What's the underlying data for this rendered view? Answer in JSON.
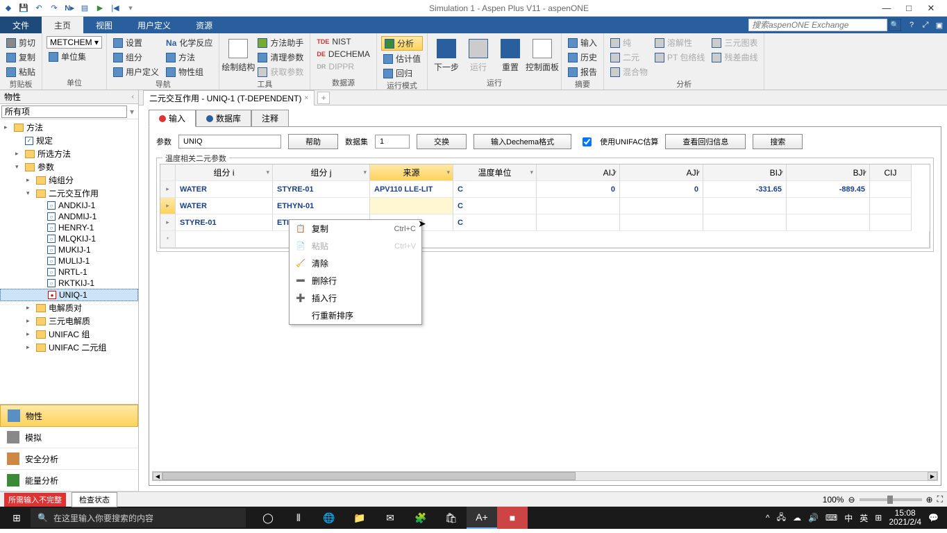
{
  "title": "Simulation 1 - Aspen Plus V11 - aspenONE",
  "search_placeholder": "搜索aspenONE Exchange",
  "ribbon_tabs": {
    "file": "文件",
    "home": "主页",
    "view": "视图",
    "custom": "用户定义",
    "res": "资源"
  },
  "ribbon": {
    "clipboard": {
      "cut": "剪切",
      "copy": "复制",
      "paste": "粘贴",
      "g": "剪贴板"
    },
    "units": {
      "combo": "METCHEM",
      "set": "单位集",
      "g": "单位"
    },
    "nav": {
      "setup": "设置",
      "comp": "组分",
      "userdef": "用户定义",
      "chem": "化学反应",
      "method": "方法",
      "propset": "物性组",
      "drawstruct": "绘制结构",
      "g": "导航"
    },
    "tools": {
      "methodassist": "方法助手",
      "cleanparam": "清理参数",
      "getparam": "获取参数",
      "g": "工具"
    },
    "datasrc": {
      "nist": "NIST",
      "dechema": "DECHEMA",
      "dippr": "DIPPR",
      "g": "数据源"
    },
    "runmode": {
      "analyze": "分析",
      "estimate": "估计值",
      "regress": "回归",
      "g": "运行模式"
    },
    "run": {
      "next": "下一步",
      "go": "运行",
      "reset": "重置",
      "cpanel": "控制面板",
      "g": "运行"
    },
    "summary": {
      "input": "输入",
      "hist": "历史",
      "rep": "报告",
      "pure": "纯",
      "binary": "二元",
      "mix": "混合物",
      "g": "摘要"
    },
    "analysis": {
      "sol": "溶解性",
      "pt": "PT 包络线",
      "ternary": "三元图表",
      "resid": "残差曲线",
      "g": "分析"
    }
  },
  "left": {
    "title": "物性",
    "filter": "所有项",
    "tree": {
      "method": "方法",
      "spec": "规定",
      "selmethod": "所选方法",
      "param": "参数",
      "purecomp": "纯组分",
      "binary": "二元交互作用",
      "items": [
        "ANDKIJ-1",
        "ANDMIJ-1",
        "HENRY-1",
        "MLQKIJ-1",
        "MUKIJ-1",
        "MULIJ-1",
        "NRTL-1",
        "RKTKIJ-1",
        "UNIQ-1"
      ],
      "elec": "电解质对",
      "ternelec": "三元电解质",
      "unifacg": "UNIFAC 组",
      "unifacb": "UNIFAC 二元组"
    },
    "nav": {
      "props": "物性",
      "sim": "模拟",
      "safety": "安全分析",
      "energy": "能量分析"
    }
  },
  "doc_tab": "二元交互作用 - UNIQ-1 (T-DEPENDENT)",
  "subtabs": {
    "input": "输入",
    "db": "数据库",
    "notes": "注释"
  },
  "params": {
    "label": "参数",
    "value": "UNIQ",
    "help": "帮助",
    "dataset_label": "数据集",
    "dataset": "1",
    "swap": "交换",
    "dechema": "输入Dechema格式",
    "unifac": "使用UNIFAC估算",
    "viewreg": "查看回归信息",
    "search": "搜索"
  },
  "grid": {
    "legend": "温度相关二元参数",
    "headers": {
      "ci": "组分 i",
      "cj": "组分 j",
      "src": "来源",
      "tu": "温度单位",
      "aij": "AIJ",
      "aji": "AJI",
      "bij": "BIJ",
      "bji": "BJI",
      "cij": "CIJ"
    },
    "rows": [
      {
        "ci": "WATER",
        "cj": "STYRE-01",
        "src": "APV110 LLE-LIT",
        "tu": "C",
        "aij": "0",
        "aji": "0",
        "bij": "-331.65",
        "bji": "-889.45"
      },
      {
        "ci": "WATER",
        "cj": "ETHYN-01",
        "src": "",
        "tu": "C",
        "aij": "",
        "aji": "",
        "bij": "",
        "bji": ""
      },
      {
        "ci": "STYRE-01",
        "cj": "ETI",
        "src": "",
        "tu": "C",
        "aij": "",
        "aji": "",
        "bij": "",
        "bji": ""
      }
    ]
  },
  "ctx": {
    "copy": "复制",
    "copy_sc": "Ctrl+C",
    "paste": "粘贴",
    "paste_sc": "Ctrl+V",
    "clear": "清除",
    "delrow": "删除行",
    "insrow": "插入行",
    "reorder": "行重新排序"
  },
  "status": {
    "err": "所需输入不完整",
    "check": "检查状态",
    "zoom": "100%"
  },
  "taskbar": {
    "search": "在这里输入你要搜索的内容",
    "ime1": "中",
    "ime2": "英",
    "time": "15:08",
    "date": "2021/2/4"
  }
}
